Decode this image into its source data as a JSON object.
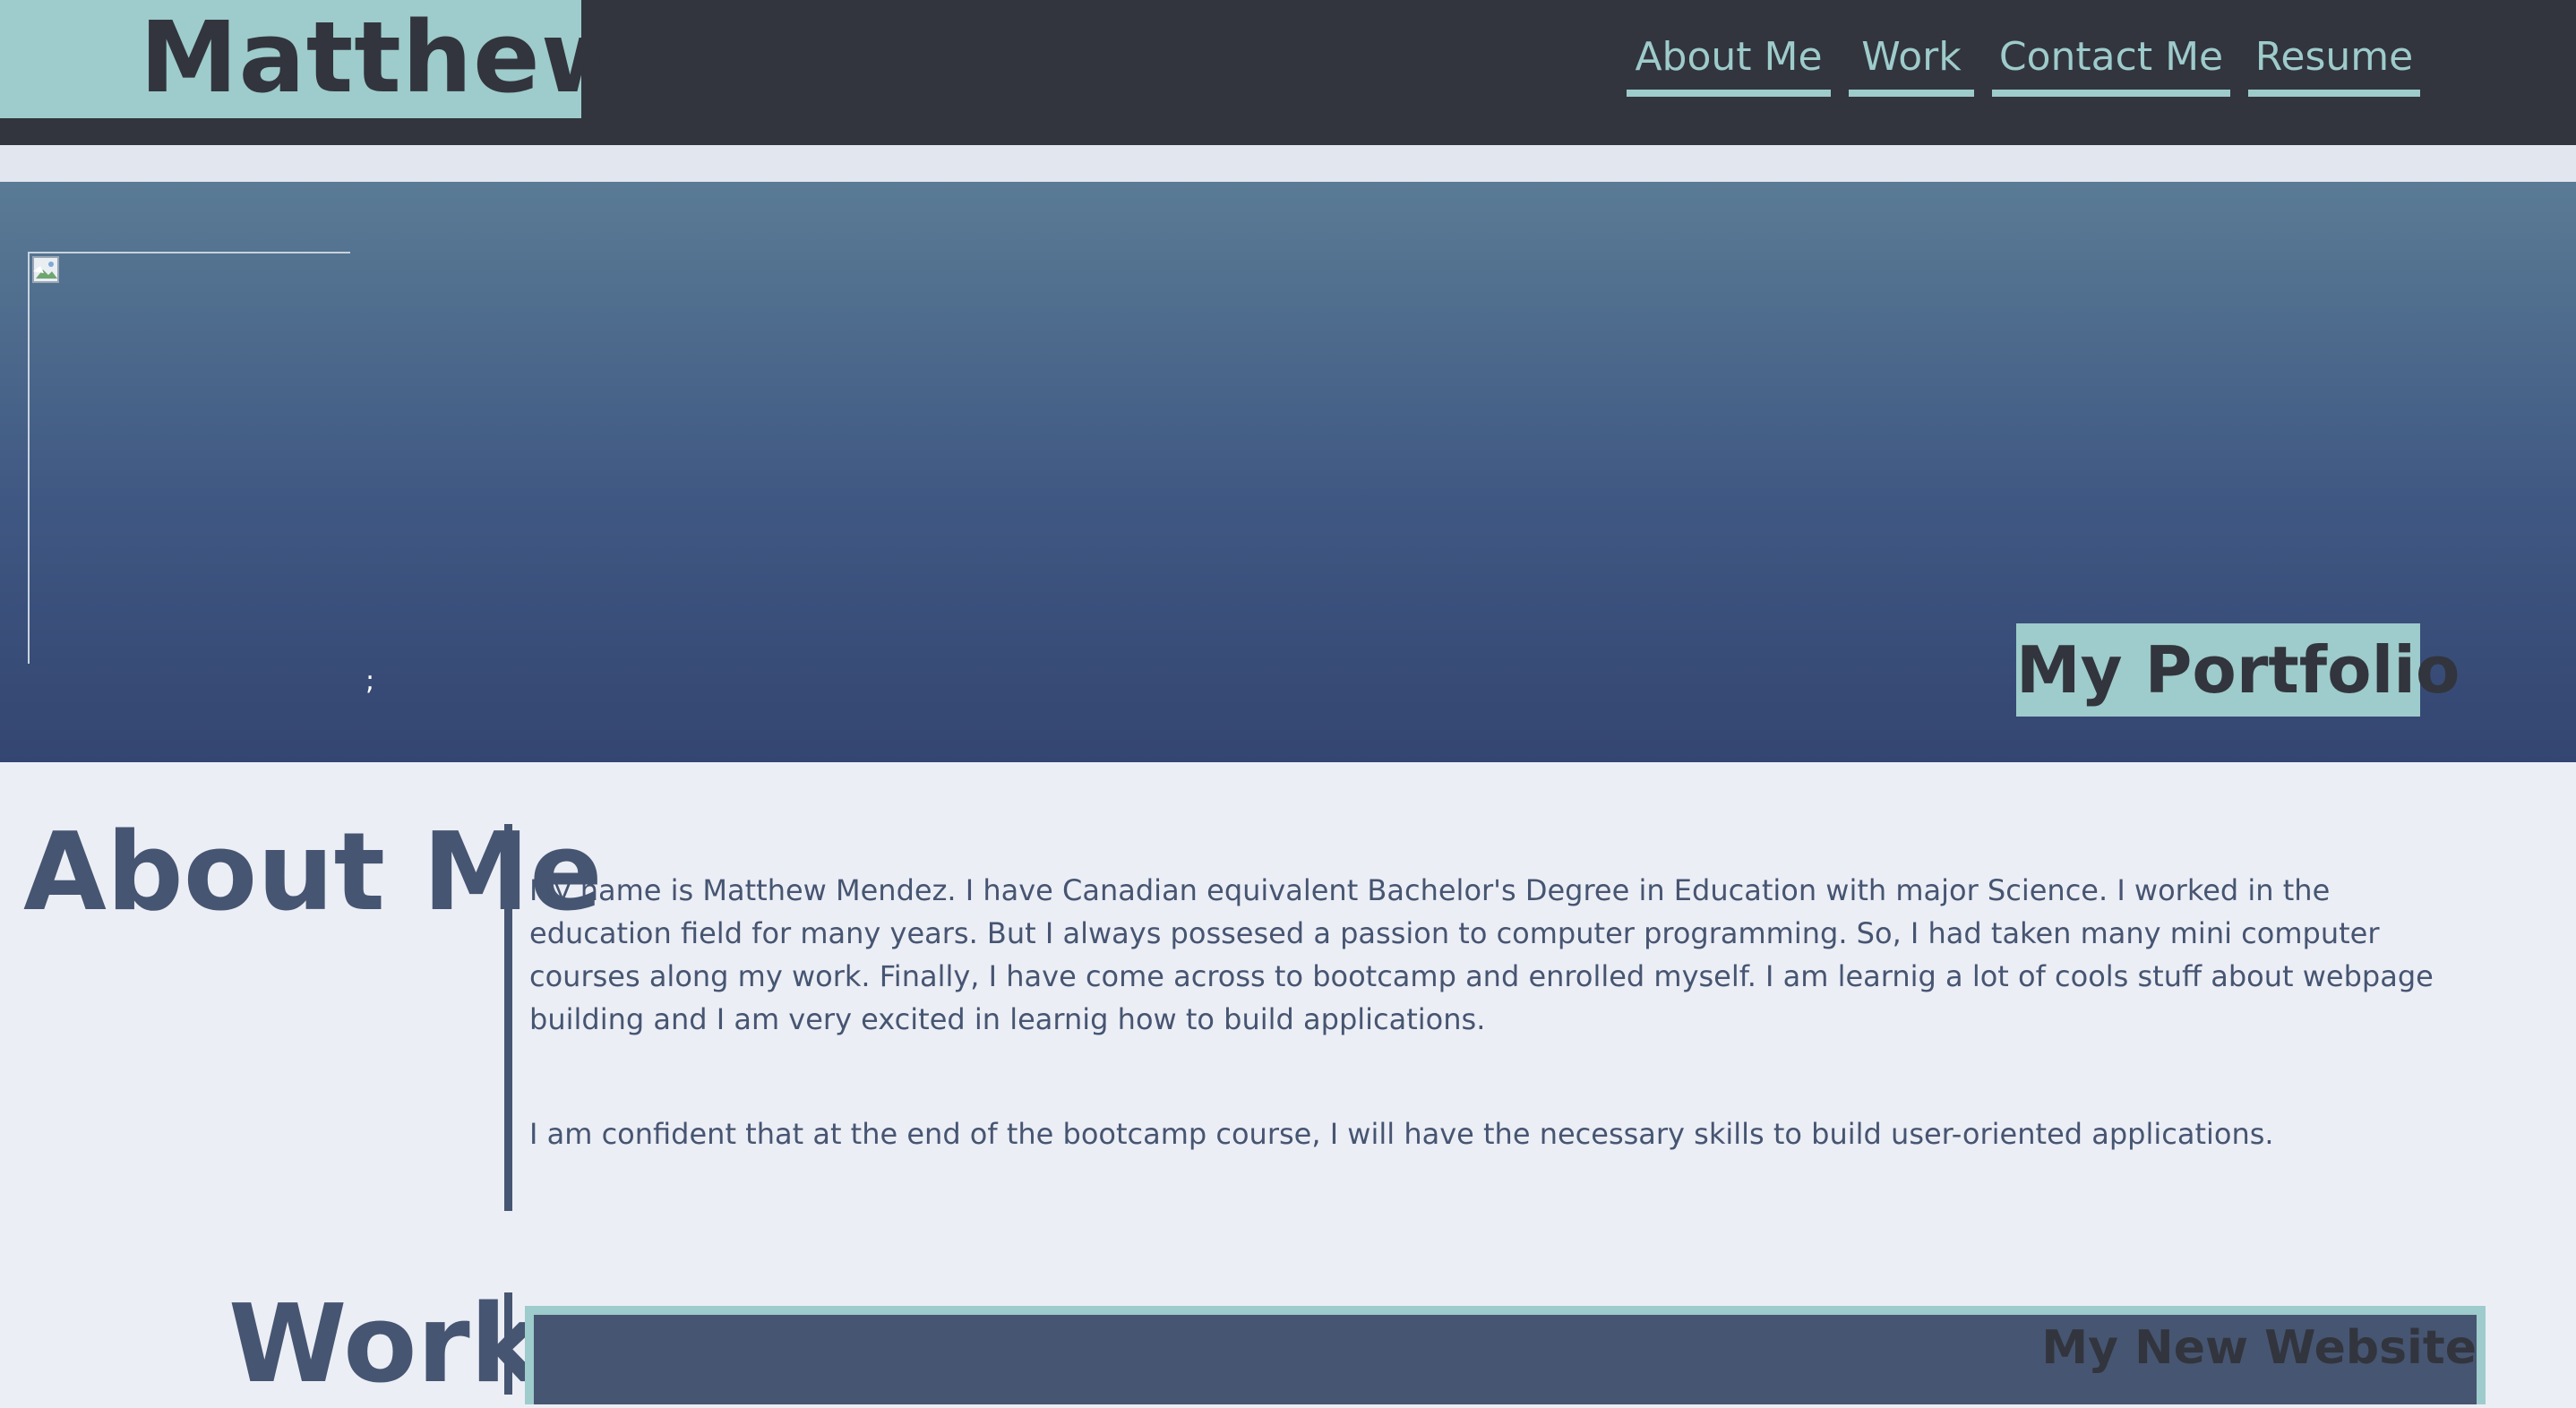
{
  "header": {
    "logo_text": "Matthew",
    "nav": [
      {
        "label": "About Me"
      },
      {
        "label": "Work"
      },
      {
        "label": "Contact Me"
      },
      {
        "label": "Resume"
      }
    ]
  },
  "hero": {
    "image_alt": "",
    "trailing_text": ";",
    "badge": "My Portfolio"
  },
  "about": {
    "heading": "About Me",
    "paragraphs": [
      "My name is Matthew Mendez. I have Canadian equivalent Bachelor's Degree in Education with major Science. I worked in the education field for many years. But I always possesed a passion to computer programming. So, I had taken many mini computer courses along my work. Finally, I have come across to bootcamp and enrolled myself. I am learnig a lot of cools stuff about webpage building and I am very excited in learnig how to build applications.",
      "I am confident that at the end of the bootcamp course, I will have the necessary skills to build user-oriented applications."
    ]
  },
  "work": {
    "heading": "Work",
    "projects": [
      {
        "title": "My New Website"
      }
    ]
  },
  "colors": {
    "dark": "#32353d",
    "accent": "#9ecbcb",
    "slate": "#465571",
    "background": "#eceef6"
  }
}
